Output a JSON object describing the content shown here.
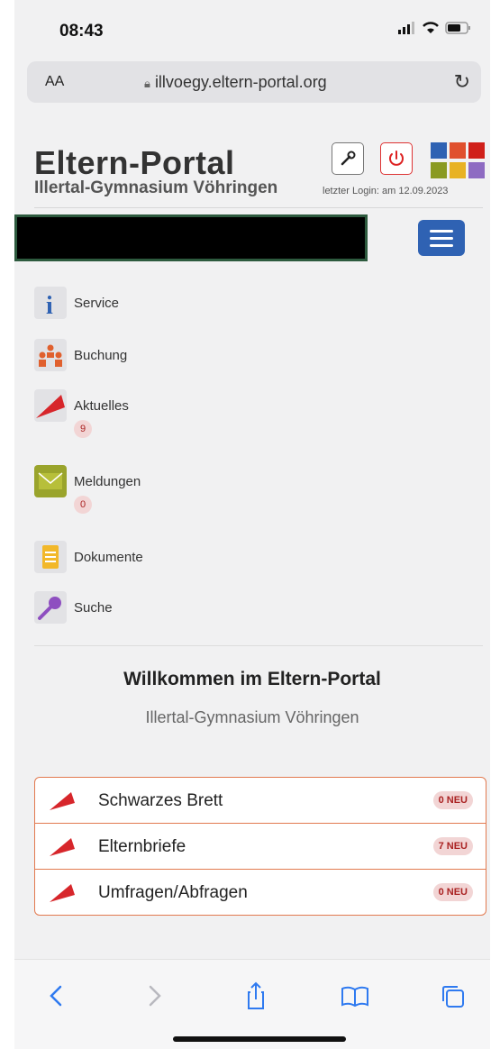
{
  "status": {
    "time": "08:43"
  },
  "browser": {
    "text_size": "AA",
    "url": "illvoegy.eltern-portal.org"
  },
  "header": {
    "brand": "Eltern-Portal",
    "school": "Illertal-Gymnasium Vöhringen",
    "last_login": "letzter Login: am 12.09.2023"
  },
  "colors": {
    "accent_blue": "#2f62b3",
    "border_orange": "#e27a50",
    "badge_bg": "#f2d5d5",
    "tiles": [
      "#2f62b3",
      "#e0502e",
      "#d0201a",
      "#8a9a22",
      "#e8b224",
      "#8e6bc2"
    ]
  },
  "nav": [
    {
      "label": "Service",
      "icon": "info-icon"
    },
    {
      "label": "Buchung",
      "icon": "people-icon"
    },
    {
      "label": "Aktuelles",
      "icon": "megaphone-icon",
      "badge": "9"
    },
    {
      "label": "Meldungen",
      "icon": "envelope-icon",
      "badge": "0"
    },
    {
      "label": "Dokumente",
      "icon": "document-icon"
    },
    {
      "label": "Suche",
      "icon": "search-icon"
    }
  ],
  "welcome": {
    "title": "Willkommen im Eltern-Portal",
    "subtitle": "Illertal-Gymnasium Vöhringen"
  },
  "panel": [
    {
      "label": "Schwarzes Brett",
      "badge": "0 NEU"
    },
    {
      "label": "Elternbriefe",
      "badge": "7 NEU"
    },
    {
      "label": "Umfragen/Abfragen",
      "badge": "0 NEU"
    }
  ]
}
